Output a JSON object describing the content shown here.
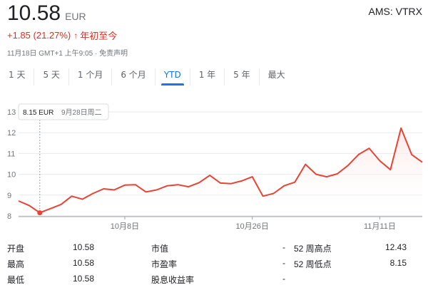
{
  "quote": {
    "price": "10.58",
    "currency": "EUR",
    "ticker": "AMS: VTRX",
    "change": "+1.85 (21.27%)",
    "change_arrow": "↑",
    "period_label": "年初至今",
    "timestamp": "11月18日 GMT+1 上午9:05",
    "separator": "·",
    "disclaimer": "免责声明"
  },
  "range_tabs": [
    {
      "label": "1 天",
      "active": false
    },
    {
      "label": "5 天",
      "active": false
    },
    {
      "label": "1 个月",
      "active": false
    },
    {
      "label": "6 个月",
      "active": false
    },
    {
      "label": "YTD",
      "active": true
    },
    {
      "label": "1 年",
      "active": false
    },
    {
      "label": "5 年",
      "active": false
    },
    {
      "label": "最大",
      "active": false
    }
  ],
  "tooltip": {
    "value": "8.15 EUR",
    "date": "9月28日周二"
  },
  "colors": {
    "line": "#e84335",
    "area": "#fce8e6",
    "accent": "#1a73e8",
    "down_text": "#d93025"
  },
  "chart_data": {
    "type": "line",
    "ylim": [
      8,
      13
    ],
    "y_ticks": [
      "8",
      "9",
      "10",
      "11",
      "12",
      "13"
    ],
    "x_ticks": [
      "10月8日",
      "10月26日",
      "11月11日"
    ],
    "series": [
      {
        "values": [
          8.72,
          8.5,
          8.15,
          8.35,
          8.55,
          8.95,
          8.8,
          9.08,
          9.3,
          9.25,
          9.48,
          9.5,
          9.15,
          9.25,
          9.45,
          9.5,
          9.4,
          9.6,
          9.95,
          9.58,
          9.55,
          9.68,
          9.88,
          8.95,
          9.08,
          9.45,
          9.62,
          10.48,
          10.0,
          9.88,
          10.02,
          10.42,
          10.95,
          11.25,
          10.65,
          10.22,
          12.22,
          10.95,
          10.58
        ]
      }
    ]
  },
  "stats": {
    "col1": [
      {
        "label": "开盘",
        "value": "10.58"
      },
      {
        "label": "最高",
        "value": "10.58"
      },
      {
        "label": "最低",
        "value": "10.58"
      }
    ],
    "col2": [
      {
        "label": "市值",
        "value": "-"
      },
      {
        "label": "市盈率",
        "value": "-"
      },
      {
        "label": "股息收益率",
        "value": "-"
      }
    ],
    "col3": [
      {
        "label": "52 周高点",
        "value": "12.43"
      },
      {
        "label": "52 周低点",
        "value": "8.15"
      }
    ]
  }
}
